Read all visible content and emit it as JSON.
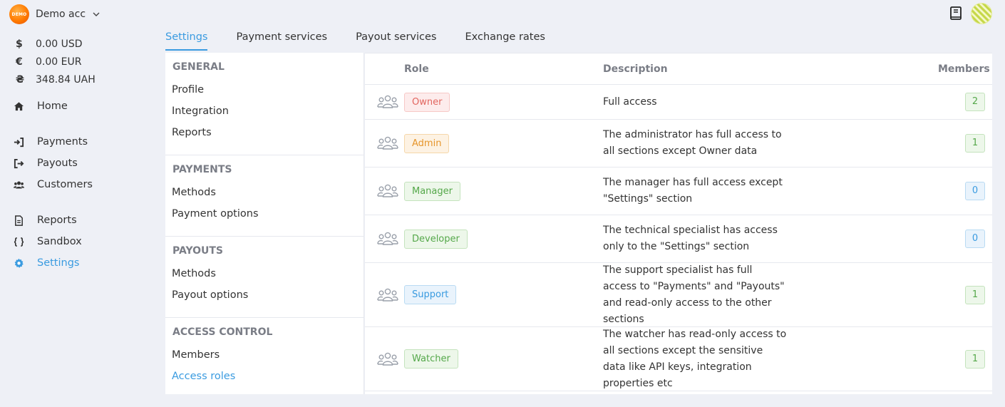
{
  "account": {
    "name": "Demo acc",
    "logo_text": "DEMO"
  },
  "balances": [
    {
      "symbol": "$",
      "value": "0.00 USD"
    },
    {
      "symbol": "€",
      "value": "0.00 EUR"
    },
    {
      "symbol": "₴",
      "value": "348.84 UAH"
    }
  ],
  "nav": {
    "home": "Home",
    "payments": "Payments",
    "payouts": "Payouts",
    "customers": "Customers",
    "reports": "Reports",
    "sandbox": "Sandbox",
    "settings": "Settings"
  },
  "tabs": {
    "settings": "Settings",
    "payment_services": "Payment services",
    "payout_services": "Payout services",
    "exchange_rates": "Exchange rates"
  },
  "menu": {
    "general": {
      "heading": "GENERAL",
      "items": [
        "Profile",
        "Integration",
        "Reports"
      ]
    },
    "payments": {
      "heading": "PAYMENTS",
      "items": [
        "Methods",
        "Payment options"
      ]
    },
    "payouts": {
      "heading": "PAYOUTS",
      "items": [
        "Methods",
        "Payout options"
      ]
    },
    "access": {
      "heading": "ACCESS CONTROL",
      "items": [
        "Members",
        "Access roles"
      ]
    }
  },
  "roles_table": {
    "headers": {
      "role": "Role",
      "description": "Description",
      "members": "Members"
    },
    "rows": [
      {
        "role": "Owner",
        "description": "Full access",
        "members": "2"
      },
      {
        "role": "Admin",
        "description": "The administrator has full access to all sections except Owner data",
        "members": "1"
      },
      {
        "role": "Manager",
        "description": "The manager has full access except \"Settings\" section",
        "members": "0"
      },
      {
        "role": "Developer",
        "description": "The technical specialist has access only to the \"Settings\" section",
        "members": "0"
      },
      {
        "role": "Support",
        "description": "The support specialist has full access to \"Payments\" and \"Payouts\" and read-only access to the other sections",
        "members": "1"
      },
      {
        "role": "Watcher",
        "description": "The watcher has read-only access to all sections except the sensitive data like API keys, integration properties etc",
        "members": "1"
      }
    ]
  },
  "colors": {
    "accent": "#3a9be0",
    "background": "#eef0f6",
    "owner": "#e2665f",
    "admin": "#e6952a",
    "success": "#55a84a"
  },
  "icons": {
    "account": "demo-logo-icon",
    "chevron": "chevron-down-icon",
    "docs": "book-icon",
    "avatar": "avatar-icon",
    "role": "user-group-icon"
  }
}
